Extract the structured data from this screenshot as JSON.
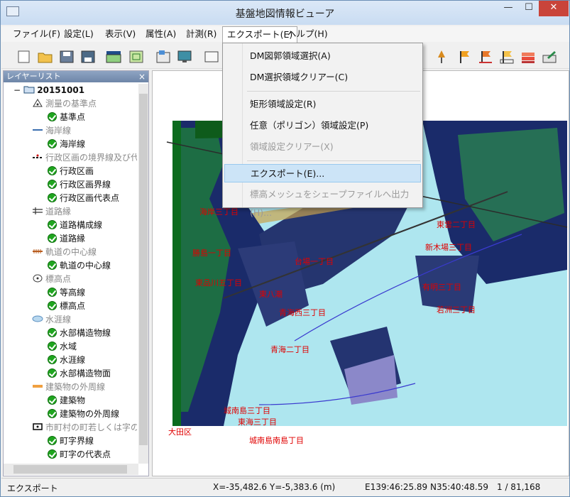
{
  "window": {
    "title": "基盤地図情報ビューア",
    "min": "—",
    "max": "☐",
    "close": "✕"
  },
  "menu": [
    {
      "label": "ファイル(F)"
    },
    {
      "label": "設定(L)"
    },
    {
      "label": "表示(V)"
    },
    {
      "label": "属性(A)"
    },
    {
      "label": "計測(R)"
    },
    {
      "label": "エクスポート(E)",
      "active": true
    },
    {
      "label": "ヘルプ(H)"
    }
  ],
  "export_menu": {
    "items": [
      {
        "label": "DM図郭領域選択(A)",
        "enabled": true
      },
      {
        "label": "DM選択領域クリアー(C)",
        "enabled": true
      },
      {
        "label": "矩形領域設定(R)",
        "enabled": true
      },
      {
        "label": "任意（ポリゴン）領域設定(P)",
        "enabled": true
      },
      {
        "label": "領域設定クリアー(X)",
        "enabled": false
      },
      {
        "label": "エクスポート(E)...",
        "enabled": true,
        "highlighted": true
      },
      {
        "label": "標高メッシュをシェープファイルへ出力(H)...",
        "enabled": false
      }
    ]
  },
  "layer_panel": {
    "title": "レイヤーリスト",
    "close": "×",
    "root": "20151001",
    "groups": [
      {
        "label": "測量の基準点",
        "items": [
          "基準点"
        ]
      },
      {
        "label": "海岸線",
        "items": [
          "海岸線"
        ]
      },
      {
        "label": "行政区画の境界線及び代",
        "items": [
          "行政区画",
          "行政区画界線",
          "行政区画代表点"
        ]
      },
      {
        "label": "道路縁",
        "items": [
          "道路構成線",
          "道路縁"
        ]
      },
      {
        "label": "軌道の中心線",
        "items": [
          "軌道の中心線"
        ]
      },
      {
        "label": "標高点",
        "items": [
          "等高線",
          "標高点"
        ]
      },
      {
        "label": "水涯線",
        "items": [
          "水部構造物線",
          "水域",
          "水涯線",
          "水部構造物面"
        ]
      },
      {
        "label": "建築物の外周線",
        "items": [
          "建築物",
          "建築物の外周線"
        ]
      },
      {
        "label": "市町村の町若しくは字の",
        "items": [
          "町字界線",
          "町字の代表点"
        ]
      }
    ]
  },
  "map": {
    "labels": [
      "大田区",
      "城南島南島丁目",
      "東海三丁目",
      "青海二丁目",
      "青海西三丁目",
      "有明三丁目",
      "東品川五丁目",
      "東八潮",
      "台場一丁目",
      "城南島三丁目",
      "新木場三丁目",
      "若洲三丁目",
      "東雲二丁目",
      "勝島一丁目",
      "海岸三丁目"
    ],
    "colors": {
      "water": "#aee6ef",
      "land": "#1a2b6a",
      "label": "#e00000"
    }
  },
  "status": {
    "mode": "エクスポート",
    "xy": "X=-35,482.6 Y=-5,383.6 (m)",
    "latlon": "E139:46:25.89 N35:40:48.59",
    "scale": "1 / 81,168"
  }
}
